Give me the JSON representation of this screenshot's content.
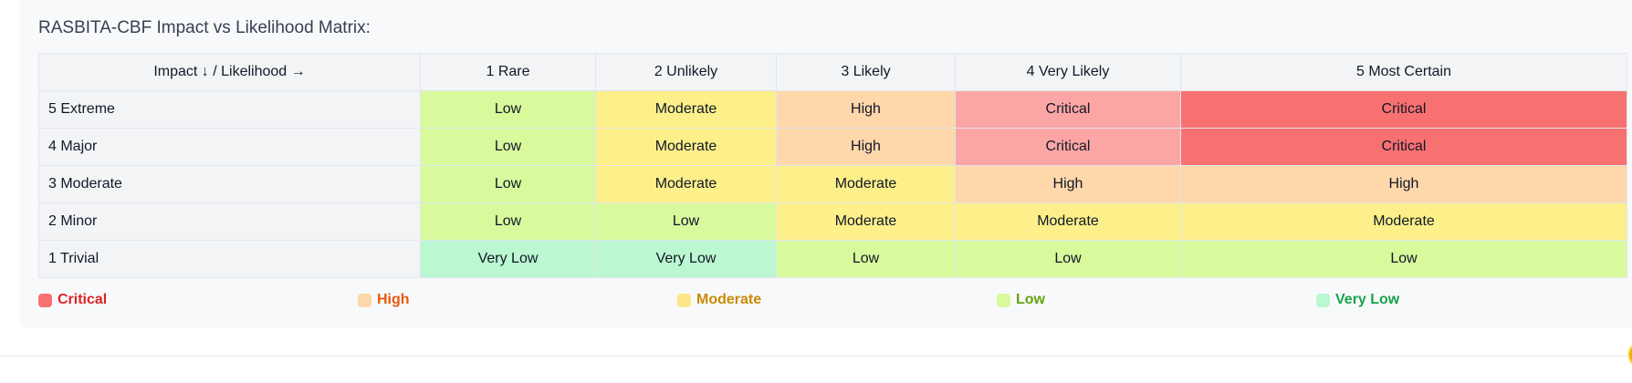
{
  "title": "RASBITA-CBF Impact vs Likelihood Matrix:",
  "matrix": {
    "corner_label": "Impact ↓ / Likelihood →",
    "columns": [
      "1 Rare",
      "2 Unlikely",
      "3 Likely",
      "4 Very Likely",
      "5 Most Certain"
    ],
    "rows": [
      {
        "label": "5 Extreme",
        "cells": [
          "Low",
          "Moderate",
          "High",
          "Critical",
          "Critical"
        ]
      },
      {
        "label": "4 Major",
        "cells": [
          "Low",
          "Moderate",
          "High",
          "Critical",
          "Critical"
        ]
      },
      {
        "label": "3 Moderate",
        "cells": [
          "Low",
          "Moderate",
          "Moderate",
          "High",
          "High"
        ]
      },
      {
        "label": "2 Minor",
        "cells": [
          "Low",
          "Low",
          "Moderate",
          "Moderate",
          "Moderate"
        ]
      },
      {
        "label": "1 Trivial",
        "cells": [
          "Very Low",
          "Very Low",
          "Low",
          "Low",
          "Low"
        ]
      }
    ]
  },
  "legend": [
    {
      "label": "Critical",
      "swatch": "#f87171",
      "text_color": "#dc2626"
    },
    {
      "label": "High",
      "swatch": "#fed7aa",
      "text_color": "#ea580c"
    },
    {
      "label": "Moderate",
      "swatch": "#fde68a",
      "text_color": "#ca8a04"
    },
    {
      "label": "Low",
      "swatch": "#d9f99d",
      "text_color": "#65a30d"
    },
    {
      "label": "Very Low",
      "swatch": "#bbf7d0",
      "text_color": "#16a34a"
    }
  ]
}
